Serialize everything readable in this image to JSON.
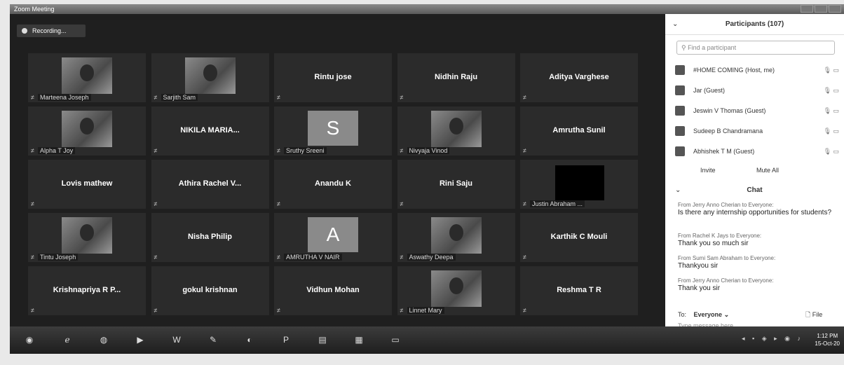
{
  "window": {
    "title": "Zoom Meeting"
  },
  "recording": {
    "label": "Recording..."
  },
  "tiles": [
    {
      "name": "Marteena Joseph",
      "kind": "video"
    },
    {
      "name": "Sarjith Sam",
      "kind": "video"
    },
    {
      "name": "Rintu jose",
      "kind": "name"
    },
    {
      "name": "Nidhin Raju",
      "kind": "name"
    },
    {
      "name": "Aditya Varghese",
      "kind": "name"
    },
    {
      "name": "Alpha T Joy",
      "kind": "video"
    },
    {
      "name": "NIKILA MARIA...",
      "kind": "name"
    },
    {
      "name": "Sruthy Sreeni",
      "kind": "avatar",
      "initial": "S"
    },
    {
      "name": "Nivyaja Vinod",
      "kind": "video"
    },
    {
      "name": "Amrutha Sunil",
      "kind": "name"
    },
    {
      "name": "Lovis mathew",
      "kind": "name"
    },
    {
      "name": "Athira Rachel V...",
      "kind": "name"
    },
    {
      "name": "Anandu K",
      "kind": "name"
    },
    {
      "name": "Rini Saju",
      "kind": "name"
    },
    {
      "name": "Justin Abraham ...",
      "kind": "black"
    },
    {
      "name": "Tintu Joseph",
      "kind": "video"
    },
    {
      "name": "Nisha Philip",
      "kind": "name"
    },
    {
      "name": "AMRUTHA V NAIR",
      "kind": "avatar",
      "initial": "A"
    },
    {
      "name": "Aswathy Deepa",
      "kind": "video"
    },
    {
      "name": "Karthik C Mouli",
      "kind": "name"
    },
    {
      "name": "Krishnapriya R P...",
      "kind": "name"
    },
    {
      "name": "gokul krishnan",
      "kind": "name"
    },
    {
      "name": "Vidhun Mohan",
      "kind": "name"
    },
    {
      "name": "Linnet Mary",
      "kind": "video"
    },
    {
      "name": "Reshma T R",
      "kind": "name"
    }
  ],
  "participants": {
    "title": "Participants (107)",
    "search_placeholder": "Find a participant",
    "list": [
      {
        "name": "#HOME COMING (Host, me)"
      },
      {
        "name": "Jar (Guest)"
      },
      {
        "name": "Jeswin V Thomas (Guest)"
      },
      {
        "name": "Sudeep B Chandramana"
      },
      {
        "name": "Abhishek T M (Guest)"
      }
    ],
    "invite_label": "Invite",
    "mute_all_label": "Mute All"
  },
  "chat": {
    "title": "Chat",
    "messages": [
      {
        "from": "From Jerry Anno Cherian to Everyone:",
        "text": "Is there any internship opportunities for students?"
      },
      {
        "from": "From Rachel K Jays to Everyone:",
        "text": "Thank you so much sir"
      },
      {
        "from": "From Sumi Sam Abraham to Everyone:",
        "text": "Thankyou sir"
      },
      {
        "from": "From Jerry Anno Cherian to Everyone:",
        "text": "Thank you sir"
      }
    ],
    "to_label": "To:",
    "to_value": "Everyone",
    "file_label": "File",
    "input_placeholder": "Type message here..."
  },
  "taskbar": {
    "time": "1:12 PM",
    "date": "15-Oct-20",
    "apps": [
      "start-orb",
      "ie-icon",
      "media-icon",
      "play-icon",
      "word-icon",
      "paint-icon",
      "chrome-icon",
      "publisher-icon",
      "explorer-icon",
      "folder-icon",
      "zoom-icon"
    ]
  }
}
